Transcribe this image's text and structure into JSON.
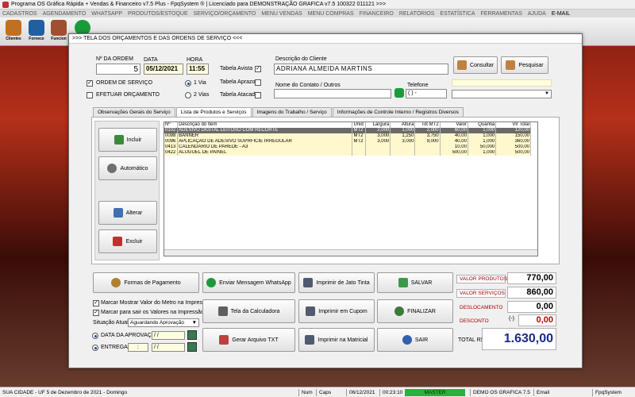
{
  "window_title": "Programa OS Gráfica Rápida + Vendas & Financeiro v7.5 Plus - FpqSystem ® | Licenciado para  DEMONSTRAÇÃO GRAFICA v7.5 100322 011121 >>>",
  "menu": [
    "CADASTROS",
    "AGENDAMENTO",
    "WHATSAPP",
    "PRODUTOS/ESTOQUE",
    "SERVIÇO/ORÇAMENTO",
    "MENU VENDAS",
    "MENU COMPRAS",
    "FINANCEIRO",
    "RELATÓRIOS",
    "ESTATÍSTICA",
    "FERRAMENTAS",
    "AJUDA",
    "E-MAIL"
  ],
  "toolbar": [
    {
      "label": "Clientes",
      "color": "#c07020"
    },
    {
      "label": "Fornece",
      "color": "#2060a0"
    },
    {
      "label": "Funcion",
      "color": "#a05030"
    }
  ],
  "form": {
    "title": ">>>  TELA DOS ORÇAMENTOS E DAS ORDENS DE SERVIÇO  <<<",
    "n_ordem_label": "Nº DA ORDEM",
    "n_ordem_value": "5",
    "data_label": "DATA",
    "data_value": "05/12/2021",
    "hora_label": "HORA",
    "hora_value": "11:55",
    "tabela_avista": "Tabela Avista",
    "tabela_aprazo": "Tabela Aprazo",
    "tabela_atacado": "Tabela Atacado",
    "ordem_servico": "ORDEM DE SERVIÇO",
    "efetuar_orcamento": "EFETUAR ORÇAMENTO",
    "via1": "1 Via",
    "via2": "2 Vias",
    "desc_cliente_label": "Descrição do Cliente",
    "desc_cliente_value": "ADRIANA ALMEIDA MARTINS",
    "contato_label": "Nome do Contato / Outros",
    "telefone_label": "Telefone",
    "telefone_value": "(   )     -",
    "consultar": "Consultar",
    "pesquisar": "Pesquisar"
  },
  "tabs": [
    "Observações Gerais do Serviço",
    "Lista de Produtos e Serviços",
    "Imagens do Trabalho / Serviço",
    "Informações de Controle Interno / Registros Diversos"
  ],
  "side_buttons": {
    "incluir": "Incluir",
    "automatico": "Automático",
    "alterar": "Alterar",
    "excluir": "Excluir"
  },
  "table": {
    "headers": [
      "Nº",
      "Descrição do Item",
      "Unid",
      "Largura",
      "Altura",
      "Tot MT2",
      "Valor",
      "Quantia",
      "Vlr Total"
    ],
    "rows": [
      [
        "0102",
        "ADESIVO DIGITAL LEITOSO COM RECORTE",
        "MT2",
        "2,000",
        "1,000",
        "2,000",
        "60,00",
        "1,000",
        "120,00"
      ],
      [
        "0098",
        "BANNER",
        "MT2",
        "3,000",
        "1,250",
        "3,750",
        "40,00",
        "1,000",
        "150,00"
      ],
      [
        "0096",
        "APLICAÇÃO DE ADESIVO SUPRFICIE IRREGULAR",
        "MT2",
        "3,000",
        "3,000",
        "9,000",
        "40,00",
        "1,000",
        "360,00"
      ],
      [
        "0413",
        "CALENDARIO DE PAREDE - A3",
        "",
        "",
        "",
        "",
        "10,00",
        "50,000",
        "500,00"
      ],
      [
        "0422",
        "ALUGUEL DE PAINEL",
        "",
        "",
        "",
        "",
        "500,00",
        "1,000",
        "500,00"
      ]
    ]
  },
  "bottom": {
    "formas_pagamento": "Formas de Pagamento",
    "whatsapp": "Enviar Mensagem WhatsApp",
    "jato_tinta": "Imprimir de Jato Tinta",
    "salvar": "SALVAR",
    "marcar_metro": "Marcar Mostrar Valor do Metro na Impressão",
    "marcar_sair": "Marcar para sair os Valores na Impressão",
    "calculadora": "Tela da Calculadora",
    "cupom": "Imprimir em Cupom",
    "finalizar": "FINALIZAR",
    "situacao_label": "Situação Atual",
    "situacao_value": "Aguardando Aprovação",
    "data_aprovacao": "DATA DA APROVAÇÃO",
    "entrega": "ENTREGA",
    "date_placeholder": "  /  /",
    "entrega_time": ":",
    "gerar_txt": "Gerar Arquivo TXT",
    "matricial": "Imprimir na Matricial",
    "sair": "SAIR"
  },
  "totals": {
    "valor_produtos_label": "VALOR PRODUTOS",
    "valor_produtos": "770,00",
    "valor_servicos_label": "VALOR SERVIÇOS",
    "valor_servicos": "860,00",
    "deslocamento_label": "DESLOCAMENTO",
    "deslocamento": "0,00",
    "desconto_label": "DESCONTO",
    "desconto_sign": "(-)",
    "desconto": "0,00",
    "total_label": "TOTAL R$",
    "total": "1.630,00"
  },
  "status": {
    "city": "SUA CIDADE - UF  5 de Dezembro de 2021 - Domingo",
    "num": "Num",
    "caps": "Caps",
    "date": "06/12/2021",
    "time": "00:23:10",
    "master": "MASTER",
    "demo": "DEMO OS GRAFICA 7.5",
    "email": "Email",
    "brand": "FpqSystem"
  }
}
